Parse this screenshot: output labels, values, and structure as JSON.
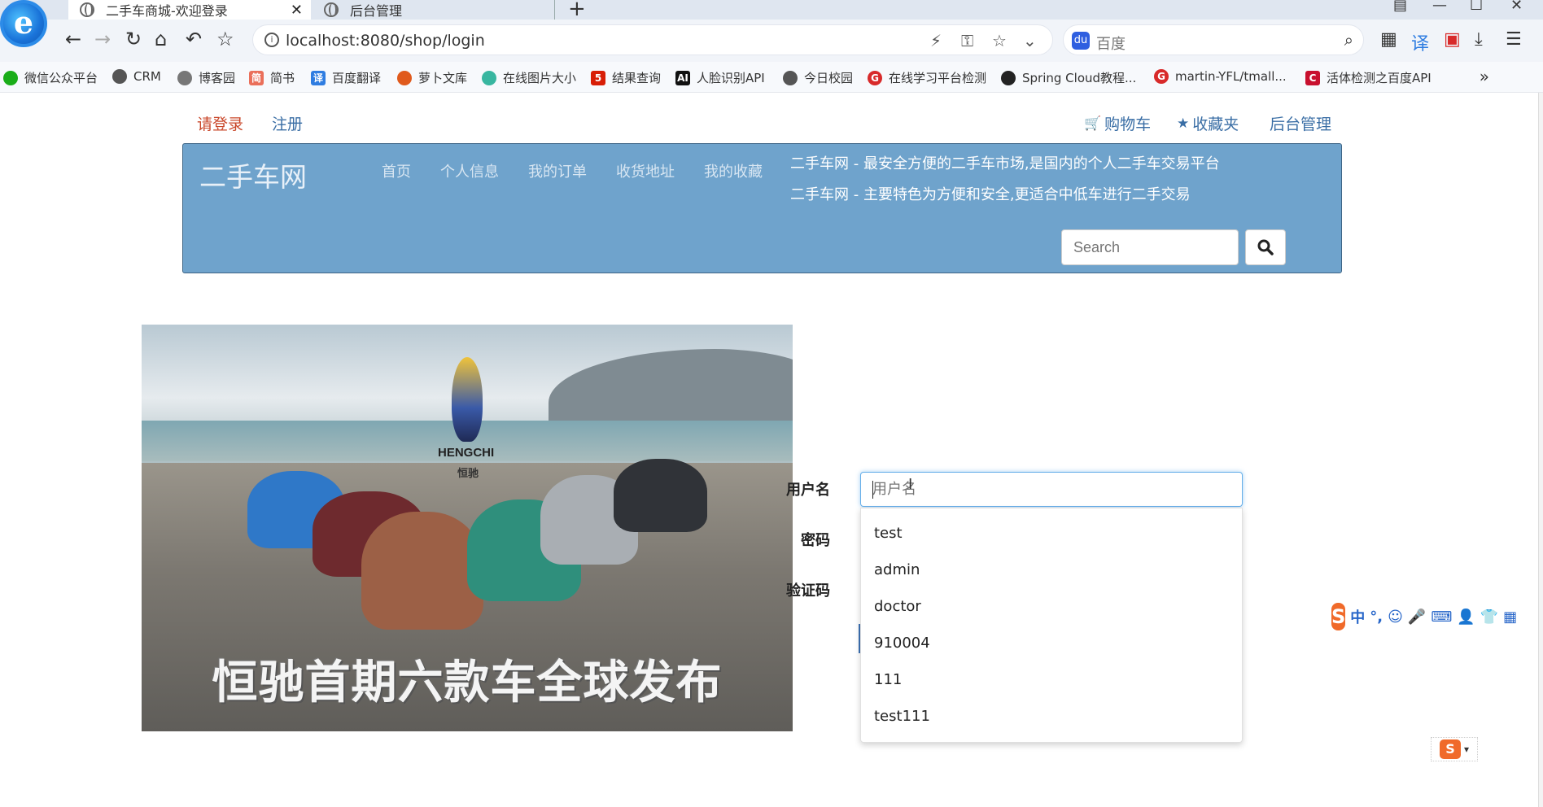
{
  "browser": {
    "tabs": [
      {
        "title": "二手车商城-欢迎登录",
        "active": true
      },
      {
        "title": "后台管理",
        "active": false
      }
    ],
    "address": "localhost:8080/shop/login",
    "search_engine": "百度",
    "bookmarks": [
      {
        "label": "微信公众平台",
        "color": "#1aad19"
      },
      {
        "label": "CRM",
        "color": "#555555"
      },
      {
        "label": "博客园",
        "color": "#555555"
      },
      {
        "label": "简书",
        "color": "#ea6f5a"
      },
      {
        "label": "百度翻译",
        "color": "#2f7de1"
      },
      {
        "label": "萝卜文库",
        "color": "#e05a1c"
      },
      {
        "label": "在线图片大小",
        "color": "#38b6a0"
      },
      {
        "label": "结果查询",
        "color": "#d81e06"
      },
      {
        "label": "人脸识别API",
        "color": "#111111"
      },
      {
        "label": "今日校园",
        "color": "#555555"
      },
      {
        "label": "在线学习平台检测",
        "color": "#d82a2a"
      },
      {
        "label": "Spring Cloud教程...",
        "color": "#222222"
      },
      {
        "label": "martin-YFL/tmall...",
        "color": "#d82a2a"
      },
      {
        "label": "活体检测之百度API",
        "color": "#c8102e"
      }
    ]
  },
  "top": {
    "login": "请登录",
    "register": "注册",
    "cart": "购物车",
    "favorites": "收藏夹",
    "admin": "后台管理"
  },
  "header": {
    "brand": "二手车网",
    "nav": [
      "首页",
      "个人信息",
      "我的订单",
      "收货地址",
      "我的收藏"
    ],
    "slogans": [
      "二手车网 - 最安全方便的二手车市场,是国内的个人二手车交易平台",
      "二手车网 - 主要特色为方便和安全,更适合中低车进行二手交易"
    ],
    "search_placeholder": "Search"
  },
  "banner": {
    "brand": "HENGCHI",
    "brand_cn": "恒驰",
    "caption": "恒驰首期六款车全球发布"
  },
  "form": {
    "username_label": "用户名",
    "password_label": "密码",
    "captcha_label": "验证码",
    "username_placeholder": "用户名",
    "suggestions": [
      "test",
      "admin",
      "doctor",
      "910004",
      "111",
      "test111"
    ]
  },
  "colors": {
    "header_bg": "#6fa3cc",
    "login_link": "#c9472a",
    "link": "#3a6ea5",
    "ime": "#f06a2a"
  }
}
